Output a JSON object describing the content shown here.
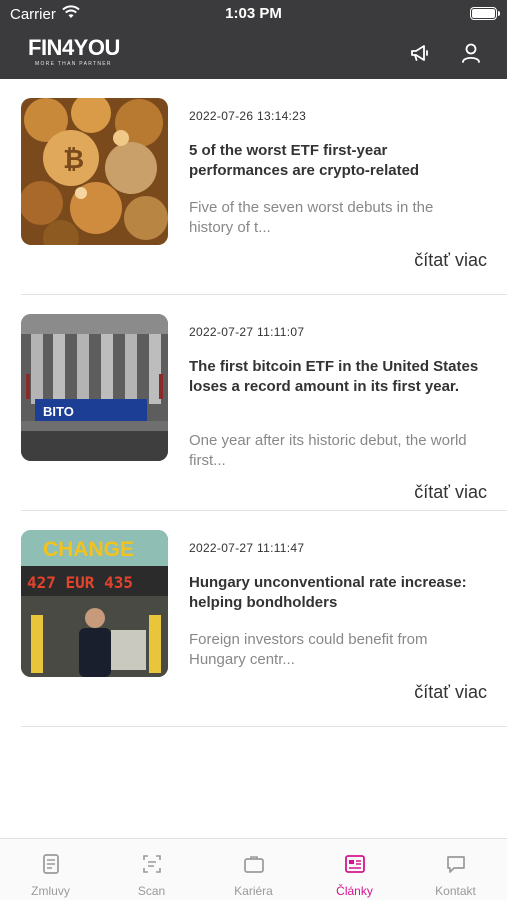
{
  "status_bar": {
    "carrier": "Carrier",
    "time": "1:03 PM"
  },
  "header": {
    "logo_text": "FIN4YOU",
    "logo_tagline": "MORE THAN PARTNER",
    "icons": [
      "megaphone-icon",
      "user-icon"
    ]
  },
  "articles": [
    {
      "date": "2022-07-26 13:14:23",
      "title": "5 of the worst ETF first-year performances are crypto-related",
      "excerpt": "Five of the seven worst debuts in the history of t...",
      "more": "čítať viac",
      "image_caption": ""
    },
    {
      "date": "2022-07-27 11:11:07",
      "title": "The first bitcoin ETF in the United States loses a record amount in its first year.",
      "excerpt": "One year after its historic debut, the world first...",
      "more": "čítať viac",
      "image_caption": "BITO"
    },
    {
      "date": "2022-07-27 11:11:47",
      "title": "Hungary unconventional rate increase: helping bondholders",
      "excerpt": "Foreign investors could benefit from Hungary centr...",
      "more": "čítať viac",
      "image_sign_top": "CHANGE",
      "image_sign_rate": "427 EUR 435"
    }
  ],
  "tabbar": {
    "tabs": [
      {
        "label": "Zmluvy",
        "icon": "document-icon",
        "active": false
      },
      {
        "label": "Scan",
        "icon": "scan-icon",
        "active": false
      },
      {
        "label": "Kariéra",
        "icon": "briefcase-icon",
        "active": false
      },
      {
        "label": "Články",
        "icon": "newspaper-icon",
        "active": true
      },
      {
        "label": "Kontakt",
        "icon": "chat-icon",
        "active": false
      }
    ],
    "active_color": "#d4148f"
  }
}
